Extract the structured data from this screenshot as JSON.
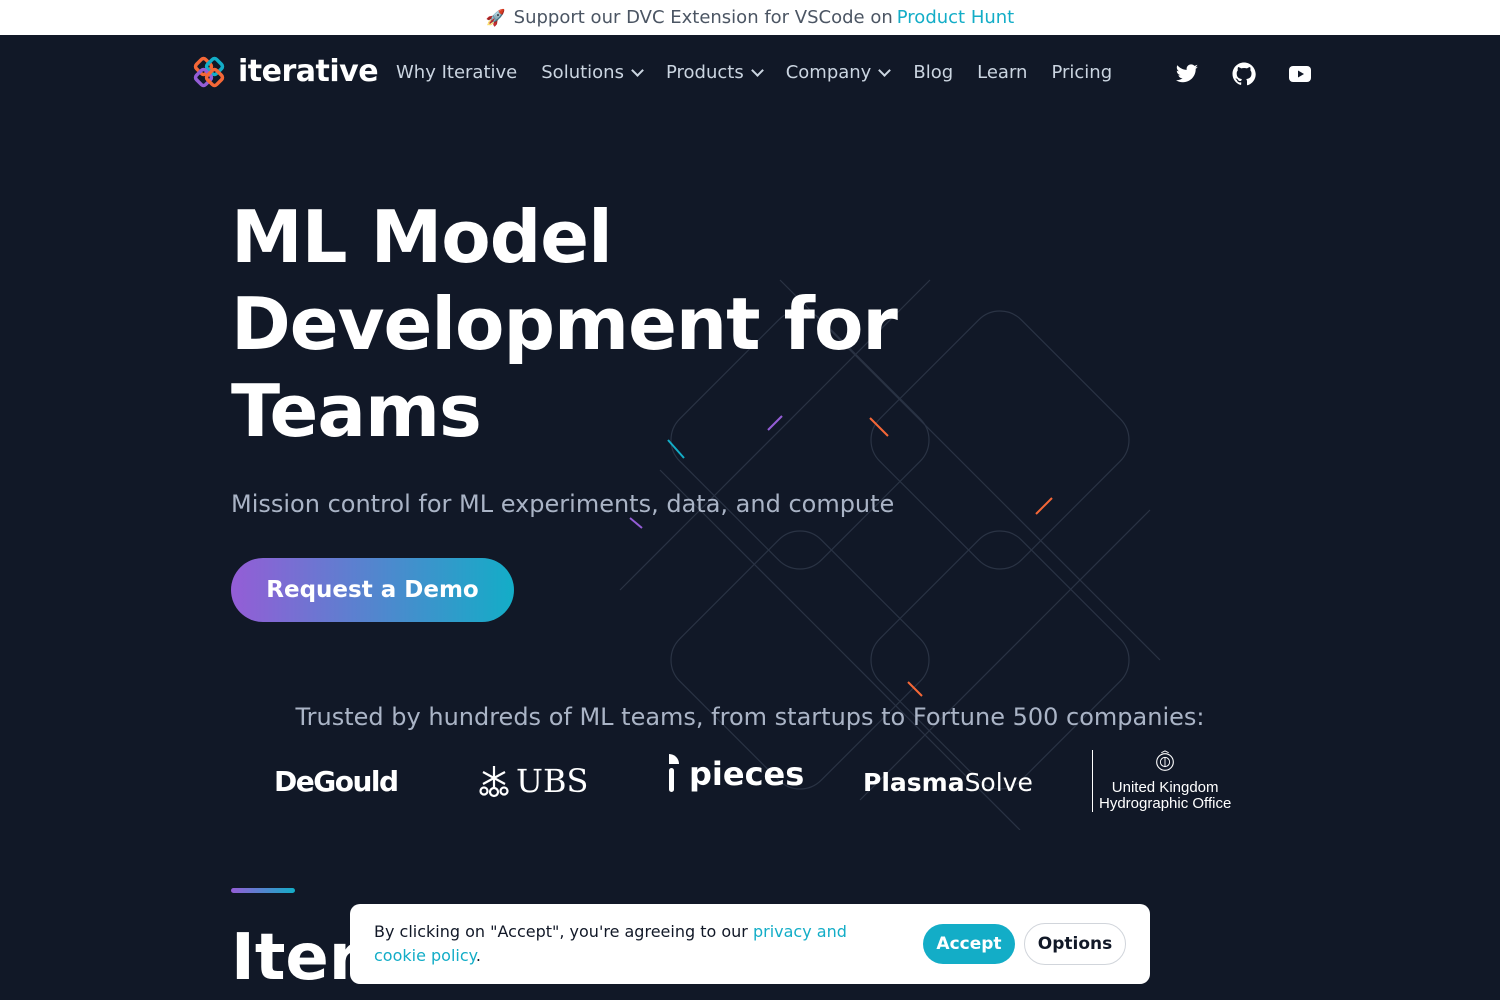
{
  "announcement": {
    "prefix": "Support our DVC Extension for VSCode on",
    "link": "Product Hunt",
    "rocket_icon": "🚀"
  },
  "nav": {
    "logo_text": "iterative",
    "items": [
      {
        "label": "Why Iterative",
        "dropdown": false
      },
      {
        "label": "Solutions",
        "dropdown": true
      },
      {
        "label": "Products",
        "dropdown": true
      },
      {
        "label": "Company",
        "dropdown": true
      },
      {
        "label": "Blog",
        "dropdown": false
      },
      {
        "label": "Learn",
        "dropdown": false
      },
      {
        "label": "Pricing",
        "dropdown": false
      }
    ],
    "social_icons": [
      "twitter-icon",
      "github-icon",
      "youtube-icon"
    ]
  },
  "hero": {
    "title_line1": "ML Model",
    "title_line2": "Development for",
    "title_line3": "Teams",
    "subtitle": "Mission control for ML experiments, data, and compute",
    "cta": "Request a Demo"
  },
  "trusted": {
    "text": "Trusted by hundreds of ML teams, from startups to Fortune 500 companies:",
    "logos": {
      "degould": "DeGould",
      "ubs": "UBS",
      "pieces": "pieces",
      "plasma_bold": "Plasma",
      "plasma_light": "Solve",
      "ukho_line1": "United Kingdom",
      "ukho_line2": "Hydrographic Office"
    }
  },
  "section": {
    "title": "Itera"
  },
  "cookie": {
    "text": "By clicking on \"Accept\", you're agreeing to our ",
    "link": "privacy and cookie policy",
    "suffix": ".",
    "accept": "Accept",
    "options": "Options"
  },
  "colors": {
    "background": "#111827",
    "accent_teal": "#13adc7",
    "accent_purple": "#945dd6"
  }
}
